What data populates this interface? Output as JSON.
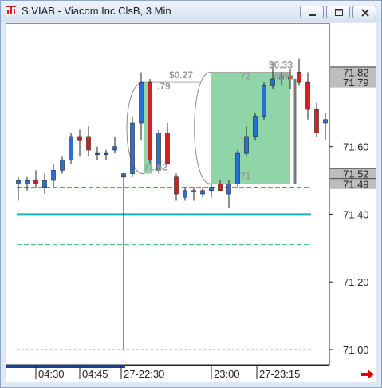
{
  "window": {
    "title": "S.VIAB - Viacom Inc ClsB, 3 Min",
    "minimize_icon": "minimize-icon",
    "maximize_icon": "maximize-icon",
    "close_icon": "close-icon"
  },
  "colors": {
    "up": "#2a6fd6",
    "down": "#d42020",
    "highlight": "#8fd5a8",
    "cyan_line": "#1ab3b8",
    "green_dash": "#2fbf6a",
    "gray_dash": "#b8b8b8",
    "price_tag_bg": "#bdbdbd",
    "arrow": "#e00000"
  },
  "chart_data": {
    "type": "candlestick",
    "symbol": "S.VIAB",
    "interval": "3 Min",
    "y_ticks": [
      "71.60",
      "71.40",
      "71.20",
      "71.00"
    ],
    "ylim": [
      70.955,
      71.965
    ],
    "x_ticks": [
      "04:30",
      "04:45",
      "27-22:30",
      "23:00",
      "27-23:15"
    ],
    "price_tags": [
      {
        "label": "71.82",
        "value": 71.82
      },
      {
        "label": "71.79",
        "value": 71.79
      },
      {
        "label": "71.52",
        "value": 71.52
      },
      {
        "label": "71.49",
        "value": 71.49
      }
    ],
    "horizontal_lines": [
      {
        "style": "green-dash",
        "value": 71.48
      },
      {
        "style": "cyan-solid",
        "value": 71.4
      },
      {
        "style": "green-dash",
        "value": 71.31
      },
      {
        "style": "gray-dash",
        "value": 71.0
      }
    ],
    "annotations": {
      "move1_label": "$0.27",
      "move1_high": ".79",
      "move1_low": "71.52",
      "move2_label": "$0.33",
      "move2_high": "72",
      "move2_pct": "46%",
      "move2_low": "71"
    },
    "candles": [
      {
        "o": 71.49,
        "h": 71.51,
        "l": 71.44,
        "c": 71.5
      },
      {
        "o": 71.49,
        "h": 71.51,
        "l": 71.47,
        "c": 71.5
      },
      {
        "o": 71.5,
        "h": 71.53,
        "l": 71.48,
        "c": 71.49
      },
      {
        "o": 71.48,
        "h": 71.52,
        "l": 71.46,
        "c": 71.5
      },
      {
        "o": 71.5,
        "h": 71.55,
        "l": 71.48,
        "c": 71.53
      },
      {
        "o": 71.53,
        "h": 71.57,
        "l": 71.52,
        "c": 71.56
      },
      {
        "o": 71.56,
        "h": 71.64,
        "l": 71.55,
        "c": 71.63
      },
      {
        "o": 71.63,
        "h": 71.65,
        "l": 71.57,
        "c": 71.62
      },
      {
        "o": 71.63,
        "h": 71.66,
        "l": 71.57,
        "c": 71.59
      },
      {
        "o": 71.58,
        "h": 71.6,
        "l": 71.56,
        "c": 71.58
      },
      {
        "o": 71.58,
        "h": 71.59,
        "l": 71.56,
        "c": 71.58
      },
      {
        "o": 71.59,
        "h": 71.63,
        "l": 71.58,
        "c": 71.6
      },
      {
        "o": 71.51,
        "h": 71.52,
        "l": 71.0,
        "c": 71.52
      },
      {
        "o": 71.52,
        "h": 71.69,
        "l": 71.51,
        "c": 71.67
      },
      {
        "o": 71.67,
        "h": 71.82,
        "l": 71.62,
        "c": 71.79
      },
      {
        "o": 71.79,
        "h": 71.8,
        "l": 71.55,
        "c": 71.56
      },
      {
        "o": 71.53,
        "h": 71.65,
        "l": 71.52,
        "c": 71.64
      },
      {
        "o": 71.64,
        "h": 71.67,
        "l": 71.55,
        "c": 71.55
      },
      {
        "o": 71.51,
        "h": 71.52,
        "l": 71.44,
        "c": 71.46
      },
      {
        "o": 71.45,
        "h": 71.48,
        "l": 71.44,
        "c": 71.47
      },
      {
        "o": 71.47,
        "h": 71.48,
        "l": 71.44,
        "c": 71.47
      },
      {
        "o": 71.46,
        "h": 71.48,
        "l": 71.45,
        "c": 71.47
      },
      {
        "o": 71.47,
        "h": 71.49,
        "l": 71.45,
        "c": 71.48
      },
      {
        "o": 71.49,
        "h": 71.5,
        "l": 71.47,
        "c": 71.47
      },
      {
        "o": 71.46,
        "h": 71.5,
        "l": 71.42,
        "c": 71.49
      },
      {
        "o": 71.49,
        "h": 71.59,
        "l": 71.48,
        "c": 71.58
      },
      {
        "o": 71.58,
        "h": 71.66,
        "l": 71.57,
        "c": 71.63
      },
      {
        "o": 71.63,
        "h": 71.7,
        "l": 71.62,
        "c": 71.69
      },
      {
        "o": 71.69,
        "h": 71.79,
        "l": 71.68,
        "c": 71.78
      },
      {
        "o": 71.78,
        "h": 71.85,
        "l": 71.77,
        "c": 71.8
      },
      {
        "o": 71.8,
        "h": 71.82,
        "l": 71.78,
        "c": 71.81
      },
      {
        "o": 71.81,
        "h": 71.83,
        "l": 71.77,
        "c": 71.8
      },
      {
        "o": 71.82,
        "h": 71.86,
        "l": 71.78,
        "c": 71.79
      },
      {
        "o": 71.79,
        "h": 71.82,
        "l": 71.68,
        "c": 71.71
      },
      {
        "o": 71.71,
        "h": 71.73,
        "l": 71.63,
        "c": 71.64
      },
      {
        "o": 71.67,
        "h": 71.7,
        "l": 71.62,
        "c": 71.68
      }
    ]
  }
}
